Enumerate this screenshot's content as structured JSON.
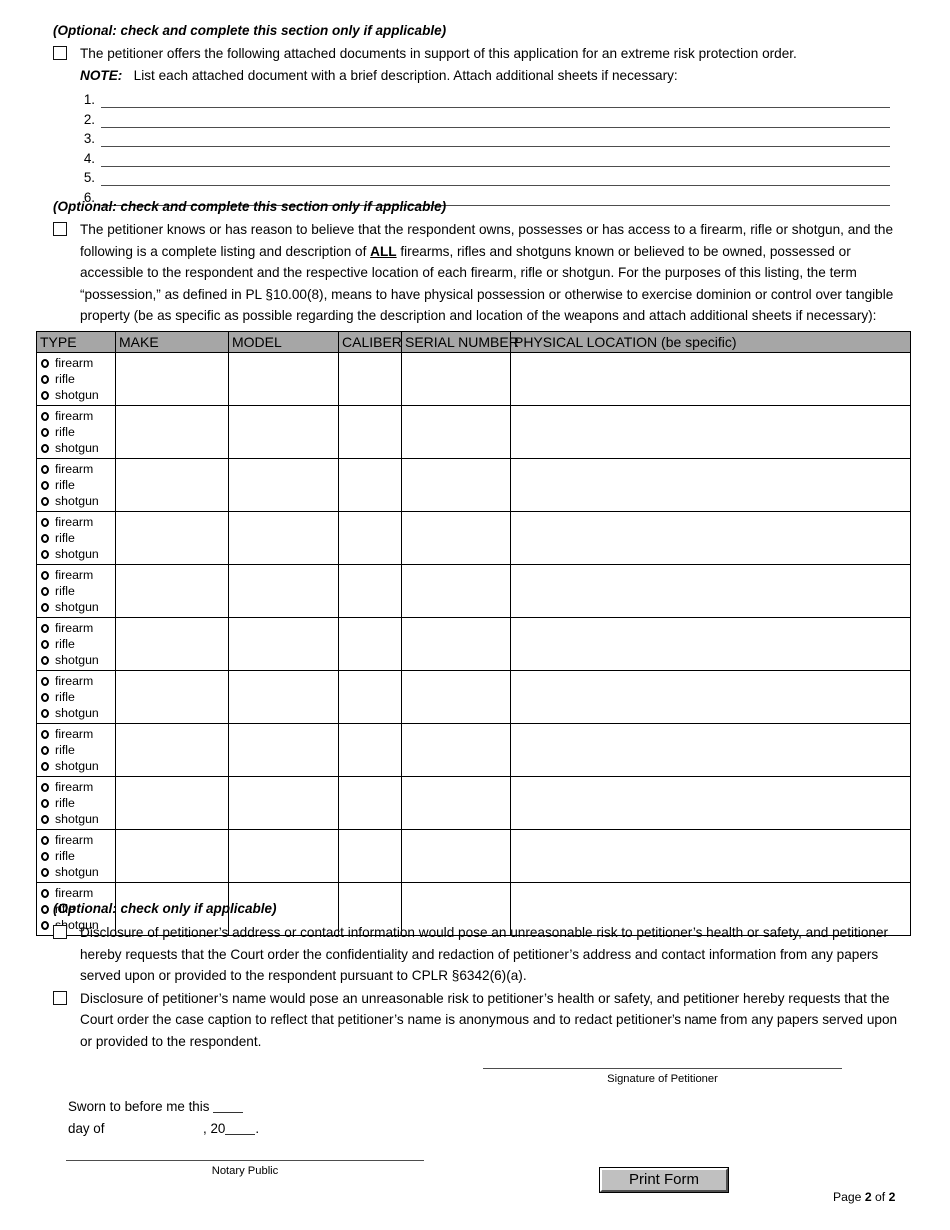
{
  "doc": {
    "footer": {
      "prefix": "Page ",
      "current": "2",
      "middle": " of ",
      "total": "2"
    }
  },
  "attached_documents": {
    "section_heading": "(Optional: check and complete this section only if applicable)",
    "checkbox_text": "The petitioner offers the following attached documents in support of this application for an extreme risk protection order.",
    "note_label": "NOTE:",
    "note_text": "List each attached document with a brief description.  Attach additional sheets if necessary:",
    "items": [
      "1.",
      "2.",
      "3.",
      "4.",
      "5.",
      "6."
    ]
  },
  "firearms": {
    "section_heading": "(Optional: check and complete this section only if applicable)",
    "paragraph_part1": "The petitioner knows or has reason to believe that the respondent owns, possesses or has access to a firearm, rifle or shotgun, and the following is a complete listing and description of ",
    "paragraph_all": "ALL",
    "paragraph_part2": " firearms, rifles and shotguns known or believed to be owned, possessed or accessible to the respondent and the respective location of each firearm, rifle or shotgun.  For the purposes of this listing, the term “possession,” as defined in PL §10.00(8), means to have physical possession or otherwise to exercise dominion or control over tangible property (be as specific as possible regarding the description and location of the weapons and attach additional sheets if necessary):",
    "table": {
      "columns": [
        "TYPE",
        "MAKE",
        "MODEL",
        "CALIBER",
        "SERIAL NUMBER",
        "PHYSICAL LOCATION (be specific)"
      ],
      "type_options": [
        "firearm",
        "rifle",
        "shotgun"
      ],
      "row_count": 11,
      "header_background": "#a6a6a6"
    }
  },
  "disclosure": {
    "section_heading": "(Optional: check only if applicable)",
    "option_address": "Disclosure of petitioner’s address or contact information would pose an unreasonable risk to petitioner’s health or safety, and petitioner hereby requests that the Court order the confidentiality and redaction of petitioner’s address and contact information from any papers served upon or provided to the respondent pursuant to CPLR §6342(6)(a).",
    "option_name_part1": "Disclosure of petitioner’s name would pose an unreasonable risk to petitioner’s health or safety, and petitioner hereby requests that the Court order the case caption to reflect that petitioner’s name is anonymous and to redact petitioner",
    "option_name_condensed": "’s name",
    "option_name_part2": " from any papers served upon or provided to the respondent."
  },
  "signatures": {
    "petitioner_caption": "Signature of Petitioner",
    "sworn_line1": "Sworn to before me this",
    "sworn_line2_label": "day of",
    "sworn_line2_year": ", 20",
    "sworn_line2_period": ".",
    "notary_caption": "Notary Public"
  },
  "actions": {
    "print_form_label": "Print Form"
  }
}
